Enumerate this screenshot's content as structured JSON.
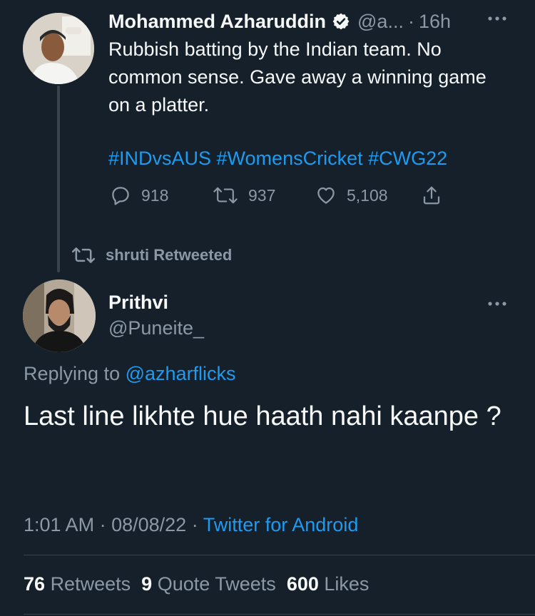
{
  "tweet": {
    "author_name": "Mohammed Azharuddin",
    "author_handle": "@a...",
    "time_separator": "·",
    "time_ago": "16h",
    "text": "Rubbish batting by the Indian team. No common sense. Gave away a winning game on a platter.",
    "hashtags": "#INDvsAUS #WomensCricket #CWG22",
    "reply_count": "918",
    "retweet_count": "937",
    "like_count": "5,108"
  },
  "retweet_banner": {
    "text": "shruti Retweeted"
  },
  "reply": {
    "author_name": "Prithvi",
    "author_handle": "@Puneite_",
    "replying_prefix": "Replying to",
    "replying_to": "@azharflicks",
    "text": "Last line likhte hue haath nahi kaanpe ?",
    "time": "1:01 AM",
    "sep1": "·",
    "date": "08/08/22",
    "sep2": "·",
    "source": "Twitter for Android"
  },
  "stats": {
    "retweets_count": "76",
    "retweets_label": "Retweets",
    "quotes_count": "9",
    "quotes_label": "Quote Tweets",
    "likes_count": "600",
    "likes_label": "Likes"
  },
  "colors": {
    "background": "#15202b",
    "text_primary": "#f7f9f9",
    "text_secondary": "#8b98a5",
    "accent_blue": "#1d9bf0",
    "divider": "#38444d"
  },
  "icons": [
    "verified-badge-icon",
    "more-icon",
    "reply-icon",
    "retweet-icon",
    "like-icon",
    "share-icon"
  ]
}
